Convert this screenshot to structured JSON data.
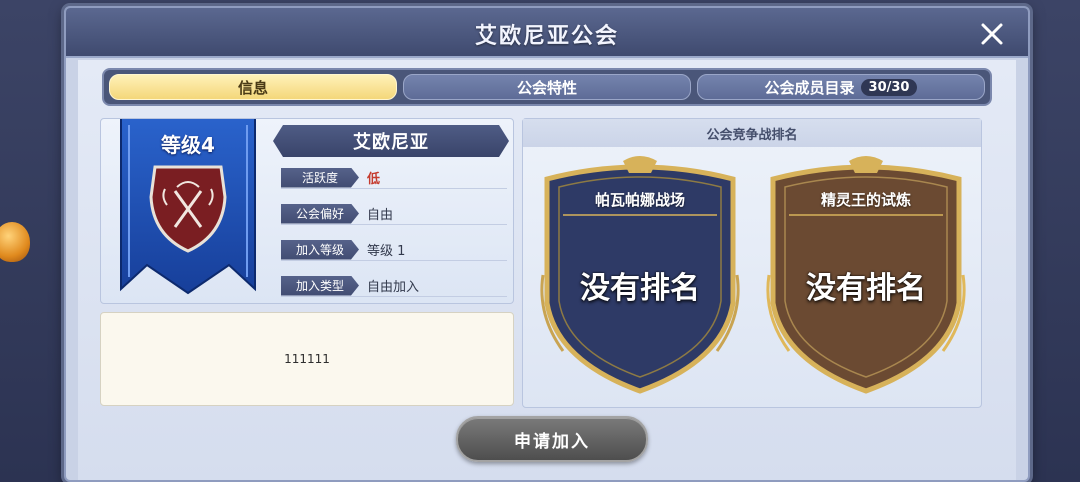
{
  "window": {
    "title": "艾欧尼亚公会"
  },
  "tabs": [
    {
      "label": "信息",
      "active": true
    },
    {
      "label": "公会特性",
      "active": false
    },
    {
      "label": "公会成员目录",
      "count": "30/30",
      "active": false
    }
  ],
  "guild": {
    "level_label": "等级4",
    "name": "艾欧尼亚",
    "fields": [
      {
        "label": "活跃度",
        "value": "低"
      },
      {
        "label": "公会偏好",
        "value": "自由"
      },
      {
        "label": "加入等级",
        "value": "等级 1"
      },
      {
        "label": "加入类型",
        "value": "自由加入"
      }
    ]
  },
  "notice": {
    "text": "111111"
  },
  "ranking": {
    "title": "公会竞争战排名",
    "arenas": [
      {
        "name": "帕瓦帕娜战场",
        "rank": "没有排名"
      },
      {
        "name": "精灵王的试炼",
        "rank": "没有排名"
      }
    ]
  },
  "actions": {
    "join_label": "申请加入"
  },
  "colors": {
    "active_tab": "#f4d77a",
    "inactive_tab": "#5e6c97",
    "banner_blue": "#1f4fb5",
    "shield_navy": "#2e3a66",
    "shield_brown": "#6b4a32",
    "gold_trim": "#d7b25a",
    "activity_low": "#c53b2e"
  }
}
